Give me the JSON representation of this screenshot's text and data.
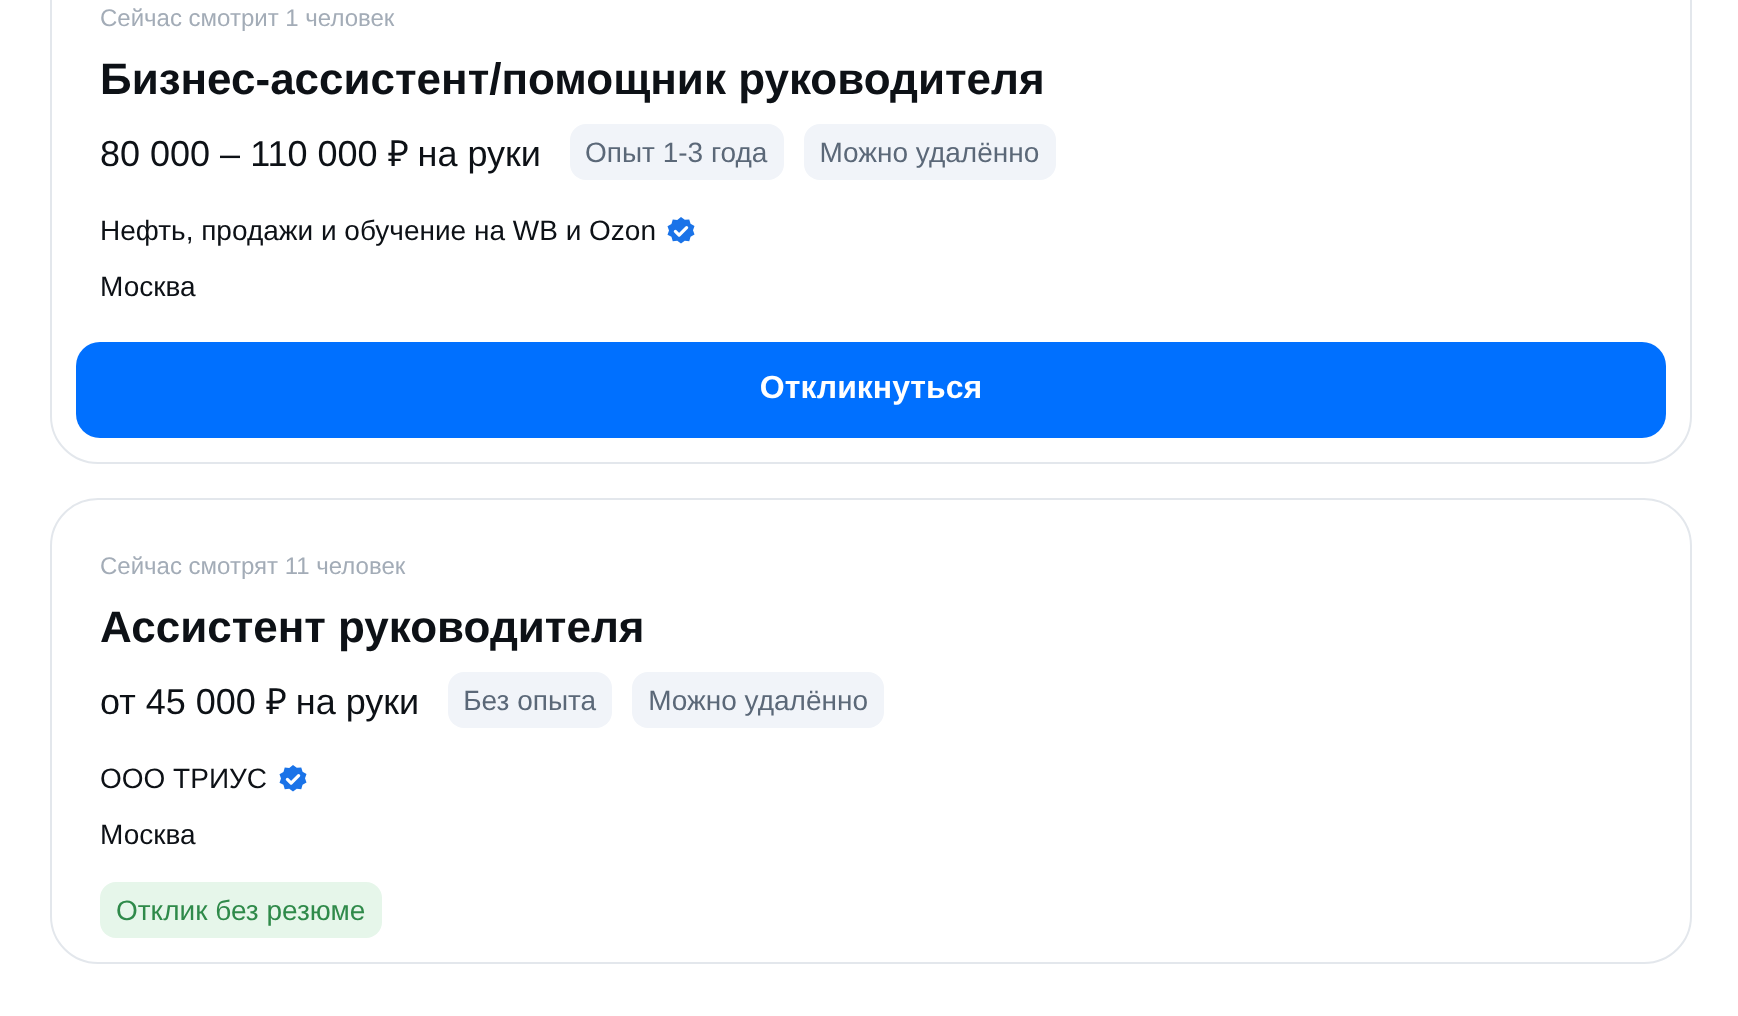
{
  "vacancies": [
    {
      "viewers": "Сейчас смотрит 1 человек",
      "title": "Бизнес-ассистент/помощник руководителя",
      "salary": "80 000 – 110 000 ₽ на руки",
      "tags": [
        "Опыт 1-3 года",
        "Можно удалённо"
      ],
      "company": "Нефть, продажи и обучение на WB и Ozon",
      "verified": true,
      "city": "Москва",
      "action": {
        "kind": "button",
        "label": "Откликнуться"
      }
    },
    {
      "viewers": "Сейчас смотрят 11 человек",
      "title": "Ассистент руководителя",
      "salary": "от 45 000 ₽ на руки",
      "tags": [
        "Без опыта",
        "Можно удалённо"
      ],
      "company": "ООО ТРИУС",
      "verified": true,
      "city": "Москва",
      "action": {
        "kind": "badge",
        "label": "Отклик без резюме"
      }
    }
  ]
}
